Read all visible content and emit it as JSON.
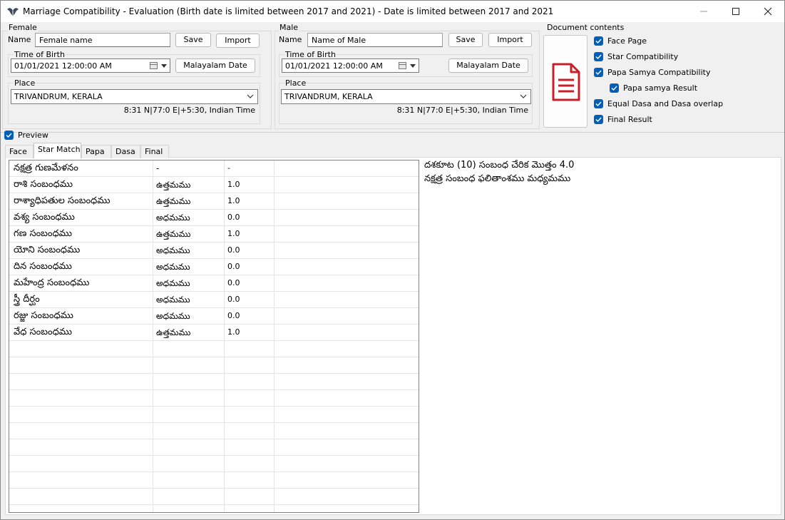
{
  "window": {
    "title": "Marriage  Compatibility - Evaluation  (Birth date is limited between 2017 and 2021)  - Date is limited between 2017 and 2021"
  },
  "female": {
    "group_label": "Female",
    "name_label": "Name",
    "name_value": "Female name",
    "save_label": "Save",
    "import_label": "Import",
    "time_group_label": "Time of Birth",
    "datetime_value": "01/01/2021  12:00:00 AM",
    "malayalam_date_label": "Malayalam Date",
    "place_group_label": "Place",
    "place_value": "TRIVANDRUM, KERALA",
    "coords": "8:31 N|77:0 E|+5:30, Indian Time"
  },
  "male": {
    "group_label": "Male",
    "name_label": "Name",
    "name_value": "Name of Male",
    "save_label": "Save",
    "import_label": "Import",
    "time_group_label": "Time of Birth",
    "datetime_value": "01/01/2021  12:00:00 AM",
    "malayalam_date_label": "Malayalam Date",
    "place_group_label": "Place",
    "place_value": "TRIVANDRUM, KERALA",
    "coords": "8:31 N|77:0 E|+5:30, Indian Time"
  },
  "document": {
    "group_label": "Document contents",
    "options": [
      {
        "label": "Face Page",
        "checked": true
      },
      {
        "label": "Star Compatibility",
        "checked": true
      },
      {
        "label": "Papa Samya Compatibility",
        "checked": true
      },
      {
        "label": "Papa samya Result",
        "checked": true
      },
      {
        "label": "Equal Dasa and Dasa overlap",
        "checked": true
      },
      {
        "label": "Final Result",
        "checked": true
      }
    ],
    "icon": "document-icon",
    "accent_color": "#c8202a"
  },
  "preview": {
    "label": "Preview",
    "checked": true
  },
  "tabs": [
    {
      "label": "Face",
      "active": false
    },
    {
      "label": "Star Match",
      "active": true
    },
    {
      "label": "Papa",
      "active": false
    },
    {
      "label": "Dasa",
      "active": false
    },
    {
      "label": "Final",
      "active": false
    }
  ],
  "star_match": {
    "rows": [
      [
        "నక్షత్ర గుణమేళనం",
        "-",
        "-"
      ],
      [
        "రాశి సంబంధము",
        "ఉత్తమము",
        "1.0"
      ],
      [
        "రాశ్యాధిపతుల సంబంధము",
        "ఉత్తమము",
        "1.0"
      ],
      [
        "వశ్య సంబంధము",
        "అధమము",
        "0.0"
      ],
      [
        "గణ సంబంధము",
        "ఉత్తమము",
        "1.0"
      ],
      [
        "యోని సంబంధము",
        "అధమము",
        "0.0"
      ],
      [
        "దిన సంబంధము",
        "అధమము",
        "0.0"
      ],
      [
        "మహేంద్ర సంబంధము",
        "అధమము",
        "0.0"
      ],
      [
        "స్త్రీ దీర్ఘం",
        "అధమము",
        "0.0"
      ],
      [
        "రజ్జు సంబంధము",
        "అధమము",
        "0.0"
      ],
      [
        "వేధ సంబంధము",
        "ఉత్తమము",
        "1.0"
      ]
    ],
    "summary_lines": [
      "దశకూట (10) సంబంధ చేరిక మొత్తం 4.0",
      "నక్షత్ర సంబంధ ఫలితాంశము మధ్యమము"
    ]
  },
  "colors": {
    "checkbox": "#005fb8",
    "window_bg": "#f0f0f0"
  }
}
